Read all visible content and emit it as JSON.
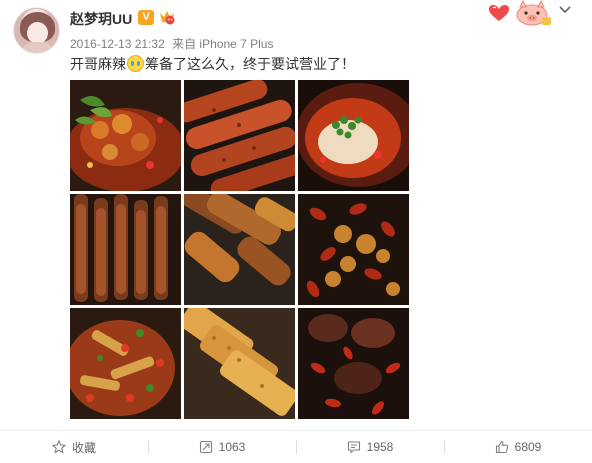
{
  "post": {
    "username": "赵梦玥UU",
    "vip_badge": "V",
    "timestamp": "2016-12-13 21:32",
    "source": "来自 iPhone 7 Plus",
    "text_before_emoji": "开哥麻辣",
    "text_after_emoji": "筹备了这么久，终于要试营业了！",
    "emoji_name": "crying-emoji"
  },
  "photos": [
    {
      "name": "photo-grilled-shrimp"
    },
    {
      "name": "photo-grilled-sausages"
    },
    {
      "name": "photo-spicy-fish-bowl"
    },
    {
      "name": "photo-meat-skewers"
    },
    {
      "name": "photo-grilled-skewers"
    },
    {
      "name": "photo-chili-stir-fry"
    },
    {
      "name": "photo-spicy-dish"
    },
    {
      "name": "photo-grilled-tofu"
    },
    {
      "name": "photo-grilled-meat-chili"
    }
  ],
  "actions": {
    "favorite": {
      "label": "收藏",
      "icon": "star-icon"
    },
    "repost": {
      "label": "1063",
      "icon": "repost-icon"
    },
    "comment": {
      "label": "1958",
      "icon": "comment-icon"
    },
    "like": {
      "label": "6809",
      "icon": "thumbs-up-icon"
    }
  },
  "colors": {
    "badge": "#f6a623",
    "text": "#333333",
    "meta": "#808080"
  }
}
